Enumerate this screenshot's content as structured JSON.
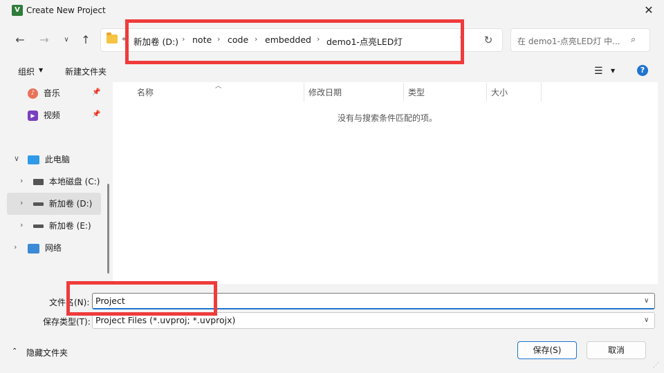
{
  "window": {
    "title": "Create New Project",
    "app_icon": "uv-icon"
  },
  "address": {
    "overflow": "«",
    "crumbs": [
      "新加卷 (D:)",
      "note",
      "code",
      "embedded",
      "demo1-点亮LED灯"
    ]
  },
  "search": {
    "placeholder": "在 demo1-点亮LED灯 中..."
  },
  "toolbar": {
    "organize_label": "组织",
    "new_folder_label": "新建文件夹",
    "help": "?"
  },
  "nav": {
    "items": [
      {
        "label": "音乐",
        "icon": "music-icon"
      },
      {
        "label": "视频",
        "icon": "video-icon"
      },
      {
        "label": "此电脑",
        "icon": "pc-icon"
      },
      {
        "label": "本地磁盘 (C:)",
        "icon": "drive-c-icon"
      },
      {
        "label": "新加卷 (D:)",
        "icon": "drive-icon"
      },
      {
        "label": "新加卷 (E:)",
        "icon": "drive-icon"
      },
      {
        "label": "网络",
        "icon": "network-icon"
      }
    ],
    "selected": "新加卷 (D:)"
  },
  "columns": [
    "名称",
    "修改日期",
    "类型",
    "大小"
  ],
  "empty_message": "没有与搜索条件匹配的项。",
  "form": {
    "filename_label": "文件名(N):",
    "filename_value": "Project",
    "filetype_label": "保存类型(T):",
    "filetype_value": "Project Files (*.uvproj; *.uvprojx)"
  },
  "footer": {
    "hide_folders_label": "隐藏文件夹",
    "save_label": "保存(S)",
    "cancel_label": "取消"
  },
  "colors": {
    "accent": "#1e74d0",
    "annotation": "#ef3b3b",
    "folder": "#f6c343"
  }
}
